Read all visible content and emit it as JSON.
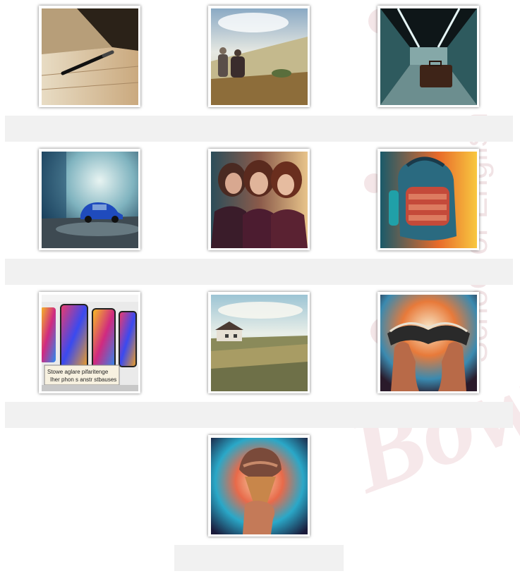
{
  "watermark": {
    "script_text": "Bow",
    "vertical_text": "School of English",
    "color": "#f3e4e6"
  },
  "gallery": {
    "items": [
      {
        "icon": "pen-on-floor-image",
        "caption": ""
      },
      {
        "icon": "couple-in-field-image",
        "caption": ""
      },
      {
        "icon": "suitcase-in-corridor-image",
        "caption": ""
      },
      {
        "icon": "blue-car-in-rain-image",
        "caption": ""
      },
      {
        "icon": "three-women-portrait-image",
        "caption": ""
      },
      {
        "icon": "colorful-backpack-image",
        "caption": ""
      },
      {
        "icon": "phones-store-image",
        "caption": "",
        "sign_text_1": "Stowe aglare pifaritenge",
        "sign_text_2": "Iher phon s anstr stbauses"
      },
      {
        "icon": "farmhouse-landscape-image",
        "caption": ""
      },
      {
        "icon": "hands-holding-book-image",
        "caption": ""
      },
      {
        "icon": "hand-holding-ice-cream-image",
        "caption": ""
      }
    ]
  }
}
